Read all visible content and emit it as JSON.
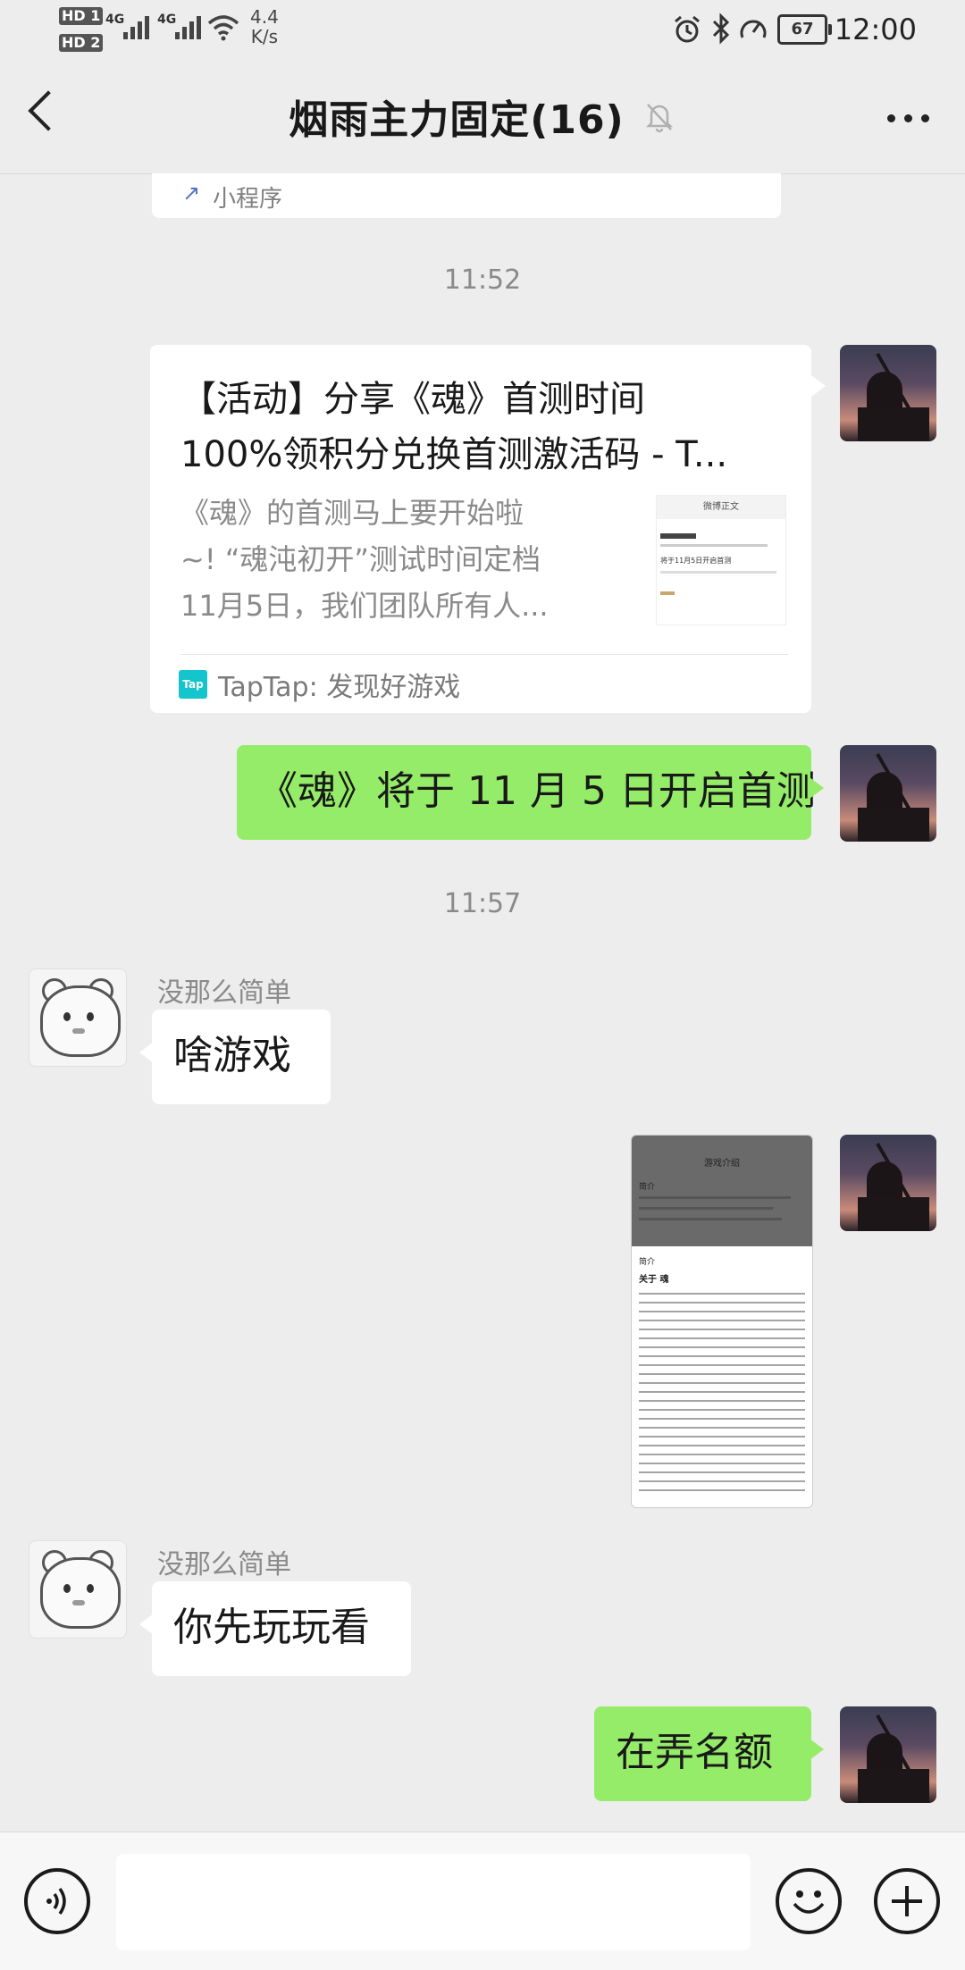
{
  "status_bar": {
    "hd1": "HD 1",
    "hd2": "HD 2",
    "net_type_1": "4G",
    "net_type_2": "4G",
    "net_speed_value": "4.4",
    "net_speed_unit": "K/s",
    "battery": "67",
    "time": "12:00"
  },
  "header": {
    "title": "烟雨主力固定(16)",
    "muted": true
  },
  "messages": {
    "mini_program_label": "小程序",
    "time_1": "11:52",
    "link_card": {
      "title": "【活动】分享《魂》首测时间100%领积分兑换首测激活码 - T...",
      "title_line1": "【活动】分享《魂》首测时间",
      "title_line2": "100%领积分兑换首测激活码 - T...",
      "desc_line1": "《魂》的首测马上要开始啦",
      "desc_line2": "~! “魂沌初开”测试时间定档",
      "desc_line3": "11月5日，我们团队所有人...",
      "source": "TapTap: 发现好游戏",
      "source_logo": "Tap",
      "thumb_header": "微博正文",
      "thumb_text": "将于11月5日开启首测"
    },
    "self_msg_1": "《魂》将于 11 月 5 日开启首测",
    "time_2": "11:57",
    "other_name_1": "没那么简单",
    "other_msg_1": "啥游戏",
    "screenshot_thumb": {
      "top_title": "游戏介绍",
      "section1": "简介",
      "section2": "简介",
      "about": "关于 魂"
    },
    "other_name_2": "没那么简单",
    "other_msg_2": "你先玩玩看",
    "self_msg_2": "在弄名额"
  },
  "input_bar": {
    "placeholder": ""
  },
  "colors": {
    "background": "#ededed",
    "bubble_green": "#95ec69",
    "bubble_white": "#ffffff",
    "tap_logo": "#14c5cd"
  }
}
